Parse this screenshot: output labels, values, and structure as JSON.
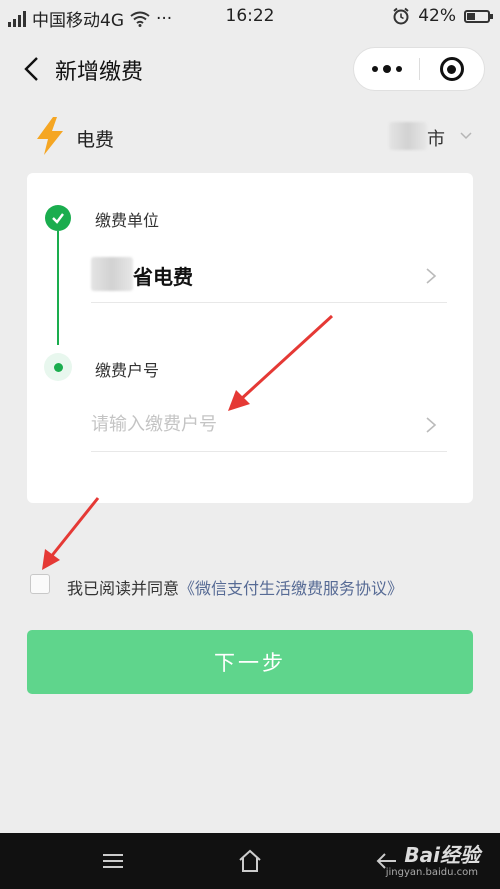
{
  "status_bar": {
    "carrier": "中国移动4G",
    "more": "···",
    "time": "16:22",
    "battery": "42%",
    "battery_level": 0.42
  },
  "nav": {
    "title": "新增缴费"
  },
  "fee": {
    "type_label": "电费",
    "city_suffix": "市"
  },
  "steps": {
    "unit_label": "缴费单位",
    "unit_value": "省电费",
    "account_label": "缴费户号",
    "account_placeholder": "请输入缴费户号",
    "account_value": ""
  },
  "agreement": {
    "text": "我已阅读并同意",
    "link": "《微信支付生活缴费服务协议》"
  },
  "next_button": "下一步",
  "watermark": {
    "brand": "Bai经验",
    "url": "jingyan.baidu.com"
  },
  "colors": {
    "accent": "#1aad4e",
    "button": "#5fd58c",
    "link": "#576b95",
    "bolt": "#f5a623",
    "annotation_arrow": "#e53935"
  }
}
